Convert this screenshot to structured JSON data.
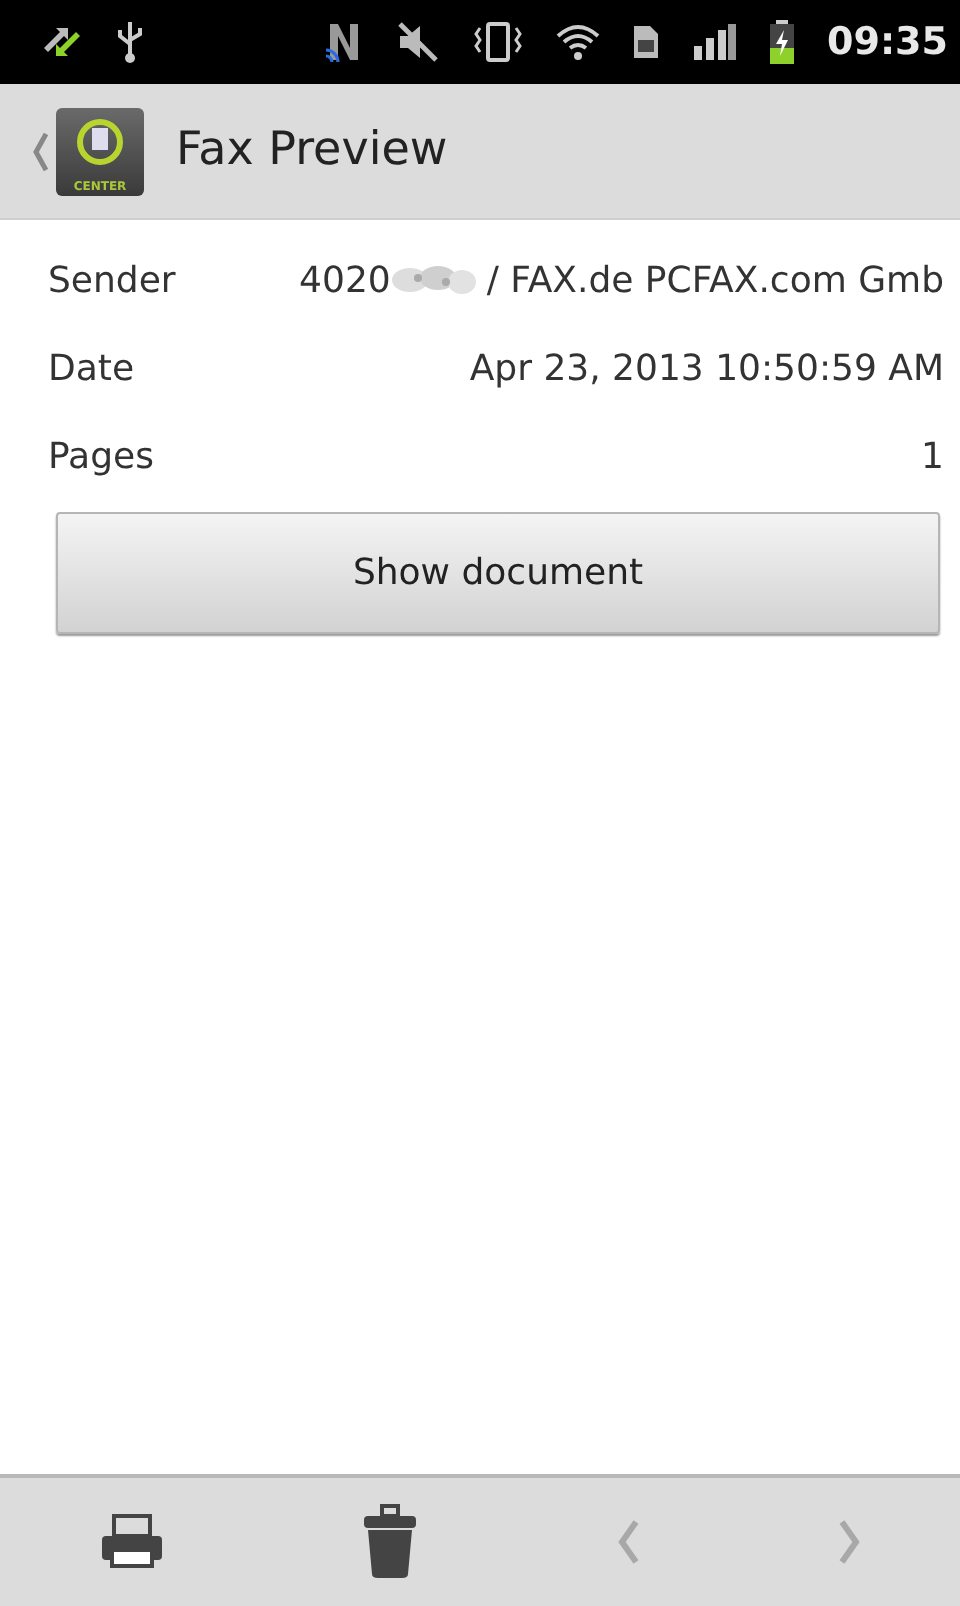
{
  "status_bar": {
    "time": "09:35"
  },
  "action_bar": {
    "title": "Fax Preview",
    "logo_text": "CENTER"
  },
  "details": [
    {
      "kind": "sender",
      "label": "Sender",
      "value_prefix": "4020",
      "value": "/ FAX.de PCFAX.com Gmb"
    },
    {
      "kind": "plain",
      "label": "Date",
      "value": "Apr 23, 2013 10:50:59 AM"
    },
    {
      "kind": "plain",
      "label": "Pages",
      "value": "1"
    }
  ],
  "show_button": "Show document",
  "toolbar": [
    {
      "kind": "print",
      "disabled": false
    },
    {
      "kind": "delete",
      "disabled": false
    },
    {
      "kind": "prev",
      "disabled": true
    },
    {
      "kind": "next",
      "disabled": true
    }
  ]
}
